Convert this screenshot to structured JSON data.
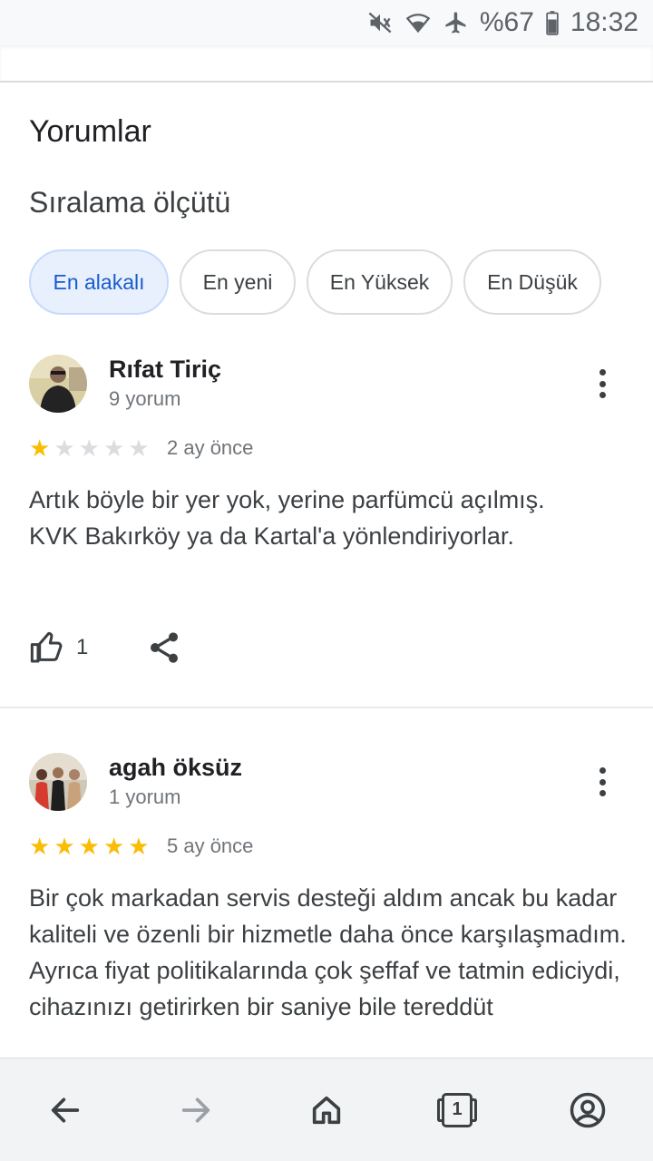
{
  "status_bar": {
    "battery": "%67",
    "time": "18:32",
    "icons": [
      "mute-icon",
      "wifi-icon",
      "airplane-icon",
      "battery-icon"
    ]
  },
  "section": {
    "title": "Yorumlar",
    "sort_label": "Sıralama ölçütü",
    "chips": [
      {
        "label": "En alakalı",
        "selected": true
      },
      {
        "label": "En yeni",
        "selected": false
      },
      {
        "label": "En Yüksek",
        "selected": false
      },
      {
        "label": "En Düşük",
        "selected": false
      }
    ]
  },
  "reviews": [
    {
      "name": "Rıfat Tiriç",
      "count": "9 yorum",
      "rating": 1,
      "max_rating": 5,
      "date": "2 ay önce",
      "text": "Artık böyle bir yer yok, yerine parfümcü açılmış.\nKVK Bakırköy ya da Kartal'a yönlendiriyorlar.",
      "likes": "1"
    },
    {
      "name": "agah öksüz",
      "count": "1 yorum",
      "rating": 5,
      "max_rating": 5,
      "date": "5 ay önce",
      "text": "Bir çok markadan servis desteği aldım ancak bu kadar kaliteli ve özenli bir hizmetle daha önce karşılaşmadım. Ayrıca fiyat politikalarında çok şeffaf ve tatmin ediciydi, cihazınızı getirirken bir saniye bile tereddüt"
    }
  ],
  "bottom_nav": {
    "tab_count": "1",
    "icons": [
      "back-arrow-icon",
      "forward-arrow-icon",
      "home-icon",
      "tabs-icon",
      "account-icon"
    ]
  },
  "colors": {
    "star_on": "#fbbc04",
    "star_off": "#dadce0",
    "chip_active_bg": "#e8f0fe",
    "chip_active_text": "#1a5bcc"
  }
}
